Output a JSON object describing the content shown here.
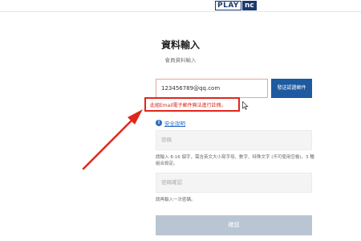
{
  "header": {
    "logo_play": "PLAY",
    "logo_nc": "nc"
  },
  "page": {
    "title": "資料輸入",
    "subtitle": "會員資料輸入"
  },
  "email": {
    "value": "123456789@qq.com",
    "verify_button": "發送認證郵件",
    "error_message": "此組Email電子郵件無法進行註冊。"
  },
  "security": {
    "link": "安全說明"
  },
  "password": {
    "placeholder": "密碼",
    "hint": "請輸入 8-16 個字，需含英文大小寫字母、數字、特殊文字 (不可使用空格)，3 種組合設定。"
  },
  "password_confirm": {
    "placeholder": "密碼確認",
    "hint": "請再輸入一次密碼。"
  },
  "submit": {
    "label": "確認"
  },
  "colors": {
    "accent": "#1e5aa0",
    "error": "#e0261b",
    "disabled_button": "#b9c5d3"
  },
  "icons": [
    "logo",
    "info-icon",
    "mouse-cursor-icon",
    "annotation-arrow"
  ]
}
